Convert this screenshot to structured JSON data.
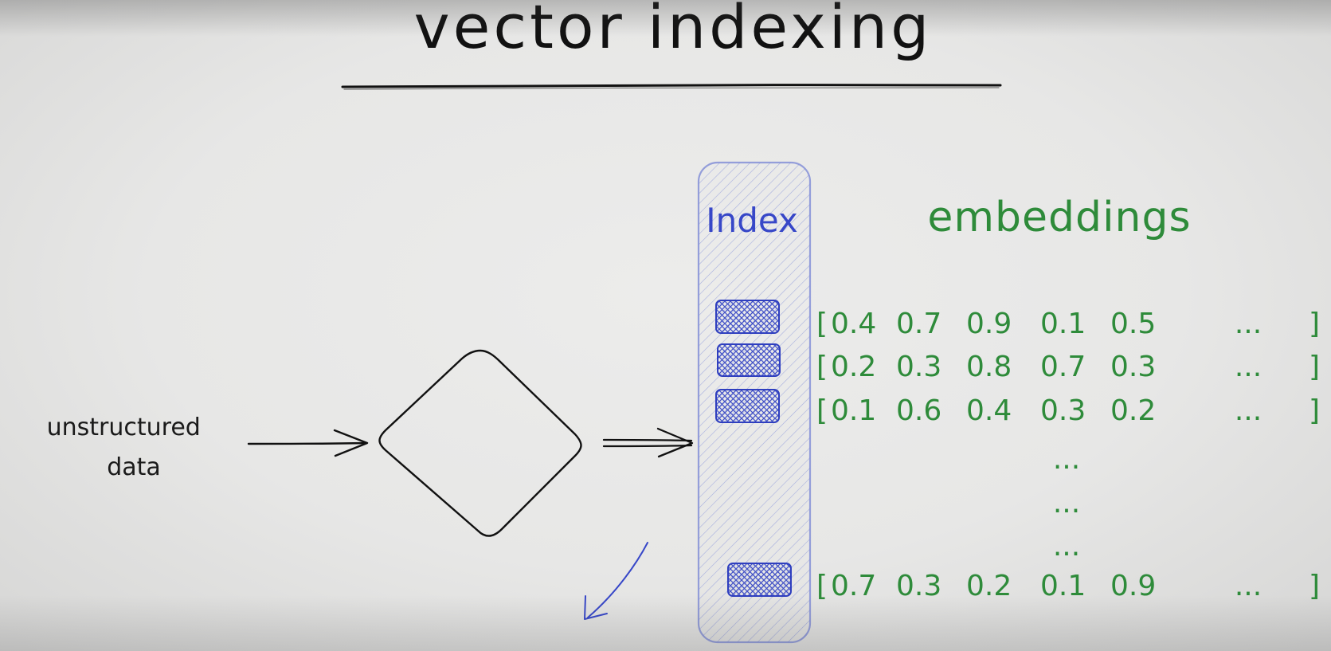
{
  "title": "vector indexing",
  "input_label": [
    "unstructured",
    "data"
  ],
  "index_label": "Index",
  "embeddings_title": "embeddings",
  "embeddings": {
    "rows": [
      {
        "values": [
          "0.4",
          "0.7",
          "0.9",
          "0.1",
          "0.5"
        ],
        "ellipsis": "...",
        "open": "[",
        "close": "]"
      },
      {
        "values": [
          "0.2",
          "0.3",
          "0.8",
          "0.7",
          "0.3"
        ],
        "ellipsis": "...",
        "open": "[",
        "close": "]"
      },
      {
        "values": [
          "0.1",
          "0.6",
          "0.4",
          "0.3",
          "0.2"
        ],
        "ellipsis": "...",
        "open": "[",
        "close": "]"
      },
      {
        "values": [
          "0.7",
          "0.3",
          "0.2",
          "0.1",
          "0.9"
        ],
        "ellipsis": "...",
        "open": "[",
        "close": "]"
      }
    ],
    "gap_ellipses": [
      "...",
      "...",
      "..."
    ]
  },
  "colors": {
    "ink": "#111111",
    "index_blue": "#3747c8",
    "embedding_green": "#2e8b3a"
  }
}
